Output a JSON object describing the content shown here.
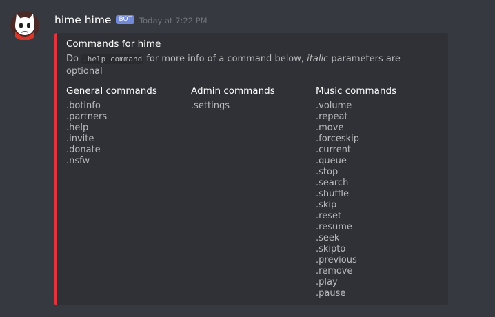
{
  "message": {
    "username": "hime hime",
    "bot_tag": "BOT",
    "timestamp": "Today at 7:22 PM"
  },
  "colors": {
    "background": "#36393f",
    "embed_background": "#2f3136",
    "embed_accent": "#e0343e",
    "bot_tag": "#7289da"
  },
  "embed": {
    "title": "Commands for hime",
    "description": {
      "prefix": "Do ",
      "code": ".help command",
      "middle": " for more info of a command below, ",
      "italic": "italic",
      "suffix": " parameters are optional"
    },
    "fields": [
      {
        "title": "General commands",
        "commands": [
          ".botinfo",
          ".partners",
          ".help",
          ".invite",
          ".donate",
          ".nsfw"
        ]
      },
      {
        "title": "Admin commands",
        "commands": [
          ".settings"
        ]
      },
      {
        "title": "Music commands",
        "commands": [
          ".volume",
          ".repeat",
          ".move",
          ".forceskip",
          ".current",
          ".queue",
          ".stop",
          ".search",
          ".shuffle",
          ".skip",
          ".reset",
          ".resume",
          ".seek",
          ".skipto",
          ".previous",
          ".remove",
          ".play",
          ".pause"
        ]
      }
    ]
  }
}
